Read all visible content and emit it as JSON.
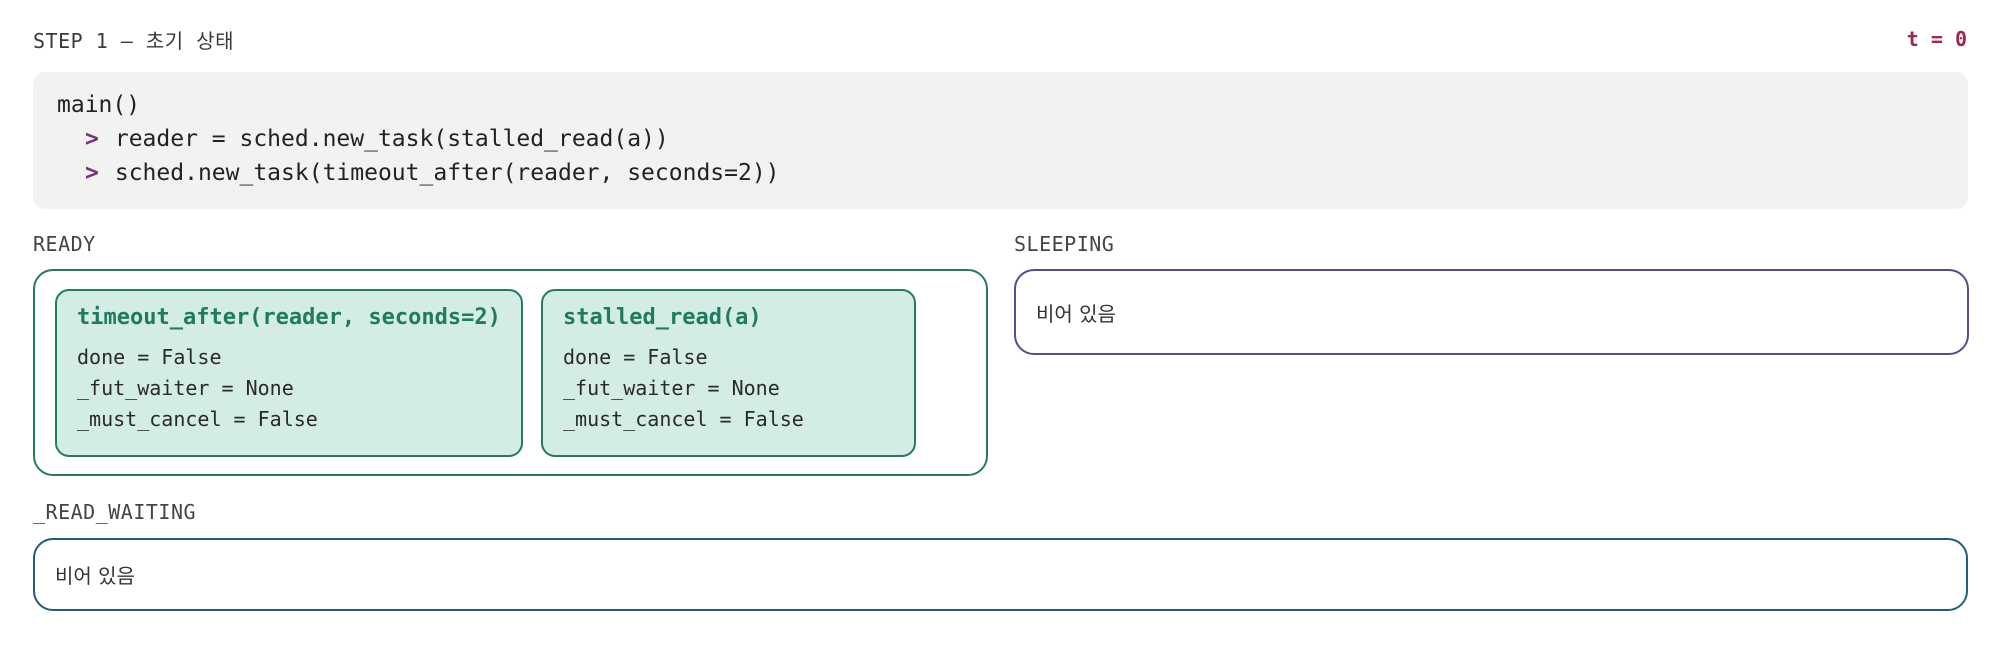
{
  "header": {
    "step_title": "STEP 1 — 초기 상태",
    "time_label": "t = 0"
  },
  "code": {
    "lines": [
      "main()",
      "reader = sched.new_task(stalled_read(a))",
      "sched.new_task(timeout_after(reader, seconds=2))"
    ],
    "prompt_symbol": ">"
  },
  "ready": {
    "label": "READY",
    "tasks": [
      {
        "name": "timeout_after(reader, seconds=2)",
        "fields": [
          "done = False",
          "_fut_waiter = None",
          "_must_cancel = False"
        ]
      },
      {
        "name": "stalled_read(a)",
        "fields": [
          "done = False",
          "_fut_waiter = None",
          "_must_cancel = False"
        ]
      }
    ]
  },
  "sleeping": {
    "label": "SLEEPING",
    "empty_text": "비어 있음"
  },
  "read_waiting": {
    "label": "_READ_WAITING",
    "empty_text": "비어 있음"
  },
  "colors": {
    "time_accent": "#a3264f",
    "prompt": "#7a2f7e",
    "ready_border": "#247a66",
    "task_fill": "#d3ece4",
    "sleeping_border": "#5c4a8f",
    "read_border": "#1f5f7a"
  }
}
